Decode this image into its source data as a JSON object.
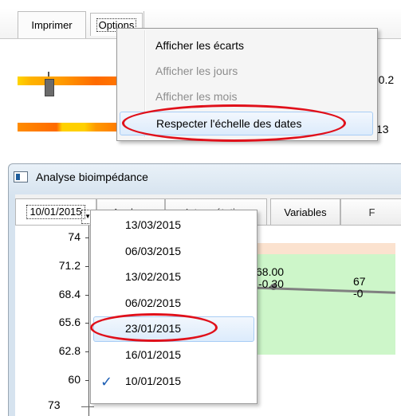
{
  "top_toolbar": {
    "imprimer_tab": "Imprimer",
    "options_tab": "Options"
  },
  "options_menu": {
    "items": [
      {
        "label": "Afficher les écarts",
        "enabled": true
      },
      {
        "label": "Afficher les jours",
        "enabled": false
      },
      {
        "label": "Afficher les mois",
        "enabled": false
      },
      {
        "label": "Respecter l'échelle des dates",
        "enabled": true,
        "highlighted": true,
        "circled": true
      }
    ]
  },
  "top_values": [
    "-0.2",
    "13"
  ],
  "window": {
    "title": "Analyse bioimpédance",
    "selected_date": "10/01/2015",
    "tabs": [
      "Analyse",
      "Interprétation",
      "Variables",
      "F"
    ]
  },
  "date_dropdown": {
    "items": [
      {
        "label": "13/03/2015",
        "checked": false
      },
      {
        "label": "06/03/2015",
        "checked": false
      },
      {
        "label": "13/02/2015",
        "checked": false
      },
      {
        "label": "06/02/2015",
        "checked": false
      },
      {
        "label": "23/01/2015",
        "checked": false,
        "highlighted": true,
        "circled": true
      },
      {
        "label": "16/01/2015",
        "checked": false
      },
      {
        "label": "10/01/2015",
        "checked": true
      }
    ]
  },
  "chart": {
    "y_ticks": [
      "74",
      "71.2",
      "68.4",
      "65.6",
      "62.8",
      "60"
    ],
    "point_labels": [
      {
        "value": "68.00",
        "delta": "-0.30"
      },
      {
        "value": "67",
        "delta": "-0"
      }
    ],
    "bottom_value": "73"
  },
  "colors": {
    "accent_red": "#e0101a",
    "chart_green": "#cdf6c9",
    "chart_pink": "#fbe2cf",
    "menu_highlight": "#dcebfc",
    "check_blue": "#1e5fb4"
  }
}
